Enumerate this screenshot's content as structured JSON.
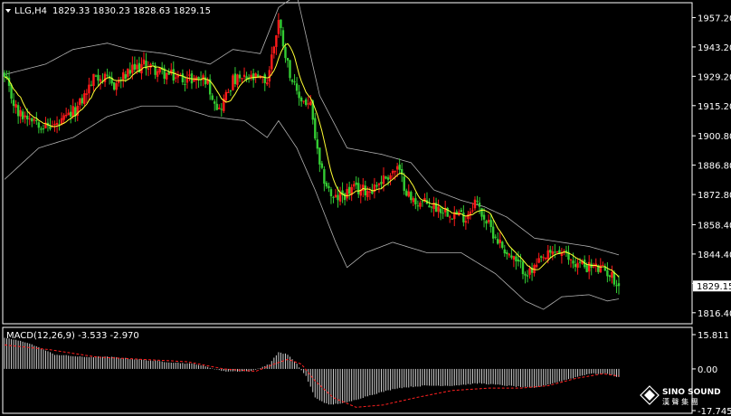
{
  "header": {
    "symbol": "LLG,H4",
    "ohlc": "1829.33 1830.23 1828.63 1829.15",
    "macd_label": "MACD(12,26,9) -3.533 -2.970"
  },
  "watermark": {
    "brand": "SINO SOUND",
    "subtitle": "漢 聲 集 團"
  },
  "colors": {
    "background": "#000000",
    "bull": "#ff1a1a",
    "bear": "#33cc33",
    "ma": "#ffff33",
    "bands": "#b0b0b0",
    "grid": "#ffffff",
    "macd_hist": "#d0d0d0",
    "macd_signal": "#ff2020",
    "price_box": "#ffffff"
  },
  "chart_data": [
    {
      "type": "candlestick",
      "panel": "price",
      "ylim": [
        1812,
        1963
      ],
      "y_ticks": [
        "1957.20",
        "1943.20",
        "1929.20",
        "1915.20",
        "1900.80",
        "1886.80",
        "1872.80",
        "1858.40",
        "1844.40",
        "1830.40",
        "1816.40"
      ],
      "current_price": "1829.15",
      "anchors": [
        [
          0,
          1928
        ],
        [
          6,
          1911
        ],
        [
          12,
          1910
        ],
        [
          18,
          1905
        ],
        [
          24,
          1906
        ],
        [
          32,
          1914
        ],
        [
          40,
          1930
        ],
        [
          48,
          1925
        ],
        [
          56,
          1932
        ],
        [
          62,
          1935
        ],
        [
          68,
          1931
        ],
        [
          74,
          1929
        ],
        [
          80,
          1928
        ],
        [
          88,
          1928
        ],
        [
          94,
          1913
        ],
        [
          100,
          1927
        ],
        [
          108,
          1928
        ],
        [
          115,
          1927
        ],
        [
          120,
          1956
        ],
        [
          124,
          1935
        ],
        [
          128,
          1920
        ],
        [
          134,
          1915
        ],
        [
          138,
          1885
        ],
        [
          144,
          1870
        ],
        [
          152,
          1875
        ],
        [
          160,
          1875
        ],
        [
          168,
          1882
        ],
        [
          172,
          1885
        ],
        [
          178,
          1870
        ],
        [
          186,
          1868
        ],
        [
          194,
          1865
        ],
        [
          202,
          1862
        ],
        [
          206,
          1870
        ],
        [
          212,
          1858
        ],
        [
          218,
          1848
        ],
        [
          224,
          1840
        ],
        [
          230,
          1835
        ],
        [
          236,
          1842
        ],
        [
          242,
          1846
        ],
        [
          250,
          1840
        ],
        [
          258,
          1838
        ],
        [
          264,
          1836
        ],
        [
          269,
          1830
        ]
      ],
      "bands_upper": [
        [
          0,
          1930
        ],
        [
          18,
          1935
        ],
        [
          30,
          1942
        ],
        [
          45,
          1945
        ],
        [
          55,
          1942
        ],
        [
          70,
          1940
        ],
        [
          90,
          1935
        ],
        [
          100,
          1942
        ],
        [
          112,
          1940
        ],
        [
          120,
          1962
        ],
        [
          128,
          1968
        ],
        [
          138,
          1920
        ],
        [
          150,
          1895
        ],
        [
          165,
          1892
        ],
        [
          178,
          1888
        ],
        [
          188,
          1875
        ],
        [
          200,
          1870
        ],
        [
          210,
          1867
        ],
        [
          220,
          1862
        ],
        [
          232,
          1852
        ],
        [
          244,
          1850
        ],
        [
          256,
          1848
        ],
        [
          269,
          1844
        ]
      ],
      "bands_lower": [
        [
          0,
          1880
        ],
        [
          15,
          1895
        ],
        [
          30,
          1900
        ],
        [
          45,
          1910
        ],
        [
          60,
          1915
        ],
        [
          75,
          1915
        ],
        [
          90,
          1910
        ],
        [
          105,
          1908
        ],
        [
          115,
          1900
        ],
        [
          120,
          1908
        ],
        [
          128,
          1895
        ],
        [
          136,
          1875
        ],
        [
          145,
          1850
        ],
        [
          150,
          1838
        ],
        [
          158,
          1845
        ],
        [
          170,
          1850
        ],
        [
          185,
          1845
        ],
        [
          200,
          1845
        ],
        [
          215,
          1835
        ],
        [
          228,
          1822
        ],
        [
          236,
          1818
        ],
        [
          244,
          1824
        ],
        [
          256,
          1825
        ],
        [
          264,
          1822
        ],
        [
          269,
          1823
        ]
      ]
    },
    {
      "type": "bar+line",
      "panel": "macd",
      "ylim": [
        -17.745,
        15.811
      ],
      "y_ticks": [
        "15.811",
        "0.00",
        "-17.745"
      ],
      "hist_anchors": [
        [
          0,
          13
        ],
        [
          10,
          11
        ],
        [
          22,
          6
        ],
        [
          34,
          5
        ],
        [
          46,
          5
        ],
        [
          58,
          4
        ],
        [
          70,
          3
        ],
        [
          84,
          2
        ],
        [
          96,
          -1
        ],
        [
          108,
          -1
        ],
        [
          116,
          2
        ],
        [
          120,
          7
        ],
        [
          124,
          6
        ],
        [
          128,
          2
        ],
        [
          132,
          -3
        ],
        [
          136,
          -12
        ],
        [
          142,
          -15
        ],
        [
          150,
          -14
        ],
        [
          160,
          -11
        ],
        [
          172,
          -8
        ],
        [
          184,
          -7
        ],
        [
          196,
          -7
        ],
        [
          208,
          -6
        ],
        [
          220,
          -7
        ],
        [
          232,
          -8
        ],
        [
          244,
          -5
        ],
        [
          256,
          -2
        ],
        [
          264,
          -2
        ],
        [
          269,
          -3.533
        ]
      ],
      "signal_anchors": [
        [
          0,
          10
        ],
        [
          20,
          8
        ],
        [
          40,
          5
        ],
        [
          60,
          4
        ],
        [
          80,
          3
        ],
        [
          96,
          0
        ],
        [
          110,
          -1
        ],
        [
          118,
          2
        ],
        [
          124,
          4
        ],
        [
          130,
          2
        ],
        [
          136,
          -5
        ],
        [
          144,
          -12
        ],
        [
          154,
          -16
        ],
        [
          166,
          -15
        ],
        [
          180,
          -12
        ],
        [
          196,
          -9
        ],
        [
          212,
          -8
        ],
        [
          226,
          -8
        ],
        [
          238,
          -7
        ],
        [
          250,
          -4
        ],
        [
          262,
          -2
        ],
        [
          269,
          -2.97
        ]
      ]
    }
  ]
}
